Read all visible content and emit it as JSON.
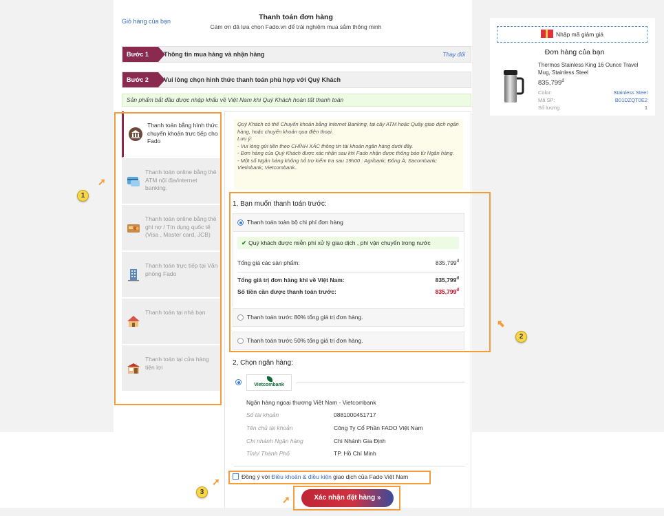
{
  "header": {
    "cart_link": "Giỏ hàng của bạn",
    "title": "Thanh toán đơn hàng",
    "subtitle": "Cám ơn đã lựa chọn Fado.vn để trải nghiệm mua sắm thông minh"
  },
  "steps": [
    {
      "tag": "Bước 1",
      "text": "Thông tin mua hàng và nhận hàng",
      "action": "Thay đổi"
    },
    {
      "tag": "Bước 2",
      "text": "Vui lòng chọn hình thức thanh toán phù hợp với Quý Khách"
    }
  ],
  "notice": "Sản phẩm bắt đầu được nhập khẩu về Việt Nam khi Quý Khách hoàn tất thanh toán",
  "methods": [
    {
      "label": "Thanh toán bằng hình thức chuyển khoản trực tiếp cho Fado",
      "icon": "bank-icon",
      "active": true
    },
    {
      "label": "Thanh toán online bằng thẻ ATM nội địa/internet banking.",
      "icon": "atm-card-icon"
    },
    {
      "label": "Thanh toán online bằng thẻ ghi nợ / Tín dụng quốc tế (Visa , Master card, JCB)",
      "icon": "credit-card-icon"
    },
    {
      "label": "Thanh toán trực tiếp tại Văn phòng Fado",
      "icon": "office-building-icon"
    },
    {
      "label": "Thanh toán tại nhà bạn",
      "icon": "house-icon"
    },
    {
      "label": "Thanh toán tại cửa hàng tiện lợi",
      "icon": "store-icon"
    }
  ],
  "transfer_info": [
    "Quý Khách có thể Chuyển khoản bằng Internet Banking, tại cây ATM hoặc Quầy giao dịch ngân hàng, hoặc chuyển khoản qua điện thoại.",
    "Lưu ý:",
    "- Vui lòng gửi tiền theo CHÍNH XÁC thông tin tài khoản ngân hàng dưới đây.",
    "- Đơn hàng của Quý Khách được xác nhận sau khi Fado nhận được thông báo từ Ngân hàng.",
    "- Một số Ngân hàng không hỗ trợ kiểm tra sau 19h00 : Agribank; Đông Á; Sacombank; Vietinbank; Vietcombank.."
  ],
  "section1": {
    "title": "1, Bạn muốn thanh toán trước:",
    "options": [
      "Thanh toán toàn bộ chi phí đơn hàng",
      "Thanh toán trước 80% tổng giá trị đơn hàng.",
      "Thanh toán trước 50% tổng giá trị đơn hàng."
    ],
    "free_note": "Quý khách được miễn phí xử lý giao dịch , phí vận chuyển trong nước",
    "rows": [
      {
        "label": "Tổng giá các sản phẩm:",
        "value": "835,799"
      },
      {
        "label": "Tổng giá trị đơn hàng khi về Việt Nam:",
        "value": "835,799"
      },
      {
        "label": "Số tiền cần được thanh toán trước:",
        "value": "835,799"
      }
    ],
    "currency": "đ"
  },
  "section2": {
    "title": "2, Chọn ngân hàng:",
    "bank_logo": "Vietcombank",
    "bank_name": "Ngân hàng ngoại thương Việt Nam - Vietcombank",
    "fields": [
      {
        "label": "Số tài khoản",
        "value": "0881000451717"
      },
      {
        "label": "Tên chủ tài khoản",
        "value": "Công Ty Cổ Phần FADO Việt Nam"
      },
      {
        "label": "Chi nhánh Ngân hàng",
        "value": "Chi Nhánh Gia Định"
      },
      {
        "label": "Tỉnh/ Thành Phố",
        "value": "TP. Hồ Chí Minh"
      }
    ]
  },
  "agree": {
    "prefix": "Đồng ý với ",
    "link": "Điều khoản & điều kiện",
    "suffix": " giao dịch của Fado Việt Nam"
  },
  "confirm_button": "Xác nhận đặt hàng »",
  "annotations": [
    "1",
    "2",
    "3"
  ],
  "cart": {
    "coupon": "Nhập mã giảm giá",
    "title": "Đơn hàng của bạn",
    "product_name": "Thermos Stainless King 16 Ounce Travel Mug, Stainless Steel",
    "price": "835,799",
    "currency": "đ",
    "color_label": "Color:",
    "color_value": "Stainless Steel",
    "sku_label": "Mã SP:",
    "sku_value": "B01DZQT0E2",
    "qty_label": "Số lượng",
    "qty_value": "1"
  },
  "colors": {
    "accent": "#8b2a4f",
    "annotation": "#f39c3a",
    "link": "#3b6cc7",
    "price_red": "#d0021b"
  }
}
